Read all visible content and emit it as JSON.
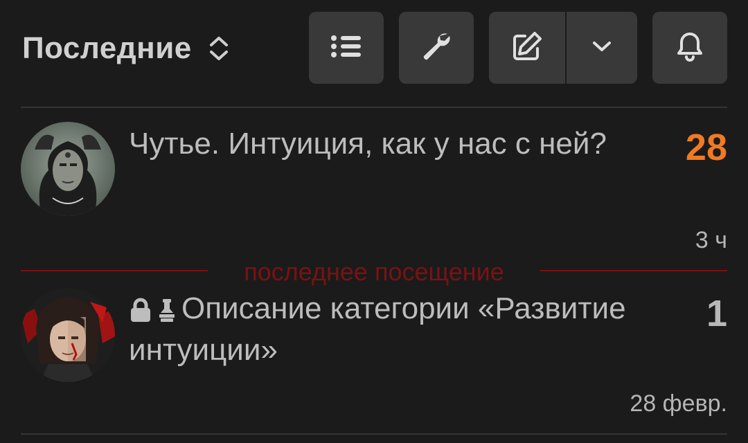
{
  "header": {
    "nav_title": "Последние",
    "nav_chevron_icon": "chevron-up-down-icon",
    "buttons": [
      {
        "name": "list",
        "icon": "list-icon"
      },
      {
        "name": "wrench",
        "icon": "wrench-icon"
      },
      {
        "name": "edit",
        "icon": "pencil-square-icon"
      },
      {
        "name": "dropdown",
        "icon": "chevron-down-icon"
      },
      {
        "name": "notifications",
        "icon": "bell-icon"
      }
    ]
  },
  "topics": [
    {
      "title": "Чутье. Интуиция, как у нас с ней?",
      "count": "28",
      "count_color": "#f07a23",
      "age": "3 ч",
      "avatar_icon": "user-avatar"
    },
    {
      "title": "Описание категории «Развитие интуиции»",
      "status_icons": [
        "lock-icon",
        "pin-icon"
      ],
      "count": "1",
      "count_color": "#b8b8b8",
      "age": "28 февр.",
      "avatar_icon": "user-avatar"
    }
  ],
  "last_visit_label": "последнее посещение",
  "colors": {
    "background": "#1b1b1b",
    "button": "#393939",
    "accent_orange": "#f07a23",
    "last_visit_red": "#7a1010"
  }
}
